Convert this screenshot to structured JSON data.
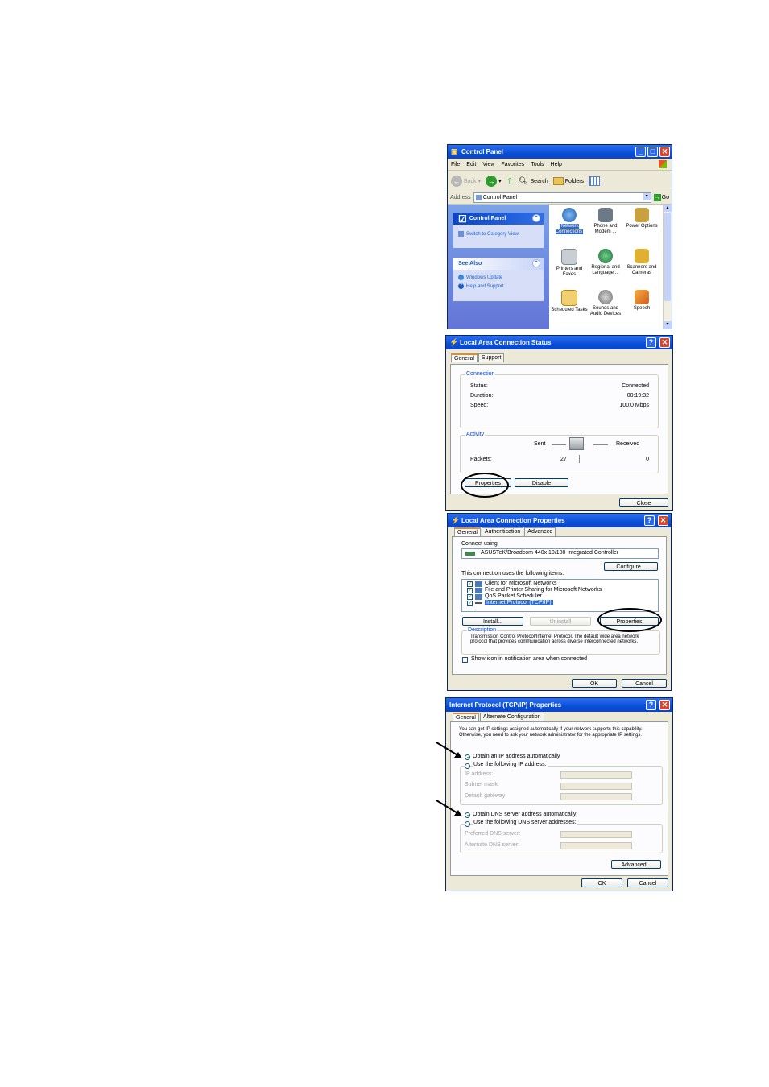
{
  "control_panel": {
    "title": "Control Panel",
    "menu": [
      "File",
      "Edit",
      "View",
      "Favorites",
      "Tools",
      "Help"
    ],
    "toolbar": {
      "back": "Back",
      "search": "Search",
      "folders": "Folders"
    },
    "address": {
      "label": "Address",
      "value": "Control Panel",
      "go": "Go"
    },
    "taskpane": {
      "title": "Control Panel",
      "switch_link": "Switch to Category View",
      "see_also_title": "See Also",
      "see_also_links": [
        "Windows Update",
        "Help and Support"
      ]
    },
    "items": [
      {
        "label": "Network Connections",
        "color": "#3a7bd5"
      },
      {
        "label": "Phone and Modem ...",
        "color": "#6c7a88"
      },
      {
        "label": "Power Options",
        "color": "#c8a040"
      },
      {
        "label": "Printers and Faxes",
        "color": "#8f9aa5"
      },
      {
        "label": "Regional and Language ...",
        "color": "#2c8a4a"
      },
      {
        "label": "Scanners and Cameras",
        "color": "#e0b030"
      },
      {
        "label": "Scheduled Tasks",
        "color": "#d9b340"
      },
      {
        "label": "Sounds and Audio Devices",
        "color": "#9a9a9a"
      },
      {
        "label": "Speech",
        "color": "#e07a20"
      }
    ]
  },
  "status_dialog": {
    "title": "Local Area Connection Status",
    "tabs": [
      "General",
      "Support"
    ],
    "connection_group": "Connection",
    "status_label": "Status:",
    "status_value": "Connected",
    "duration_label": "Duration:",
    "duration_value": "00:19:32",
    "speed_label": "Speed:",
    "speed_value": "100.0 Mbps",
    "activity_group": "Activity",
    "sent_label": "Sent",
    "received_label": "Received",
    "packets_label": "Packets:",
    "packets_sent": "27",
    "packets_received": "0",
    "properties_button": "Properties",
    "disable_button": "Disable",
    "close_button": "Close"
  },
  "properties_dialog": {
    "title": "Local Area Connection Properties",
    "tabs": [
      "General",
      "Authentication",
      "Advanced"
    ],
    "connect_using_label": "Connect using:",
    "adapter": "ASUSTeK/Broadcom 440x 10/100 Integrated Controller",
    "configure_button": "Configure...",
    "items_label": "This connection uses the following items:",
    "items": [
      "Client for Microsoft Networks",
      "File and Printer Sharing for Microsoft Networks",
      "QoS Packet Scheduler",
      "Internet Protocol (TCP/IP)"
    ],
    "install_button": "Install...",
    "uninstall_button": "Uninstall",
    "properties_button": "Properties",
    "description_group": "Description",
    "description_text": "Transmission Control Protocol/Internet Protocol. The default wide area network protocol that provides communication across diverse interconnected networks.",
    "show_icon_label": "Show icon in notification area when connected",
    "ok_button": "OK",
    "cancel_button": "Cancel"
  },
  "tcpip_dialog": {
    "title": "Internet Protocol (TCP/IP) Properties",
    "tabs": [
      "General",
      "Alternate Configuration"
    ],
    "intro": "You can get IP settings assigned automatically if your network supports this capability. Otherwise, you need to ask your network administrator for the appropriate IP settings.",
    "obtain_ip_auto": "Obtain an IP address automatically",
    "use_following_ip": "Use the following IP address:",
    "ip_address_label": "IP address:",
    "subnet_label": "Subnet mask:",
    "gateway_label": "Default gateway:",
    "obtain_dns_auto": "Obtain DNS server address automatically",
    "use_following_dns": "Use the following DNS server addresses:",
    "preferred_dns_label": "Preferred DNS server:",
    "alternate_dns_label": "Alternate DNS server:",
    "advanced_button": "Advanced...",
    "ok_button": "OK",
    "cancel_button": "Cancel"
  }
}
